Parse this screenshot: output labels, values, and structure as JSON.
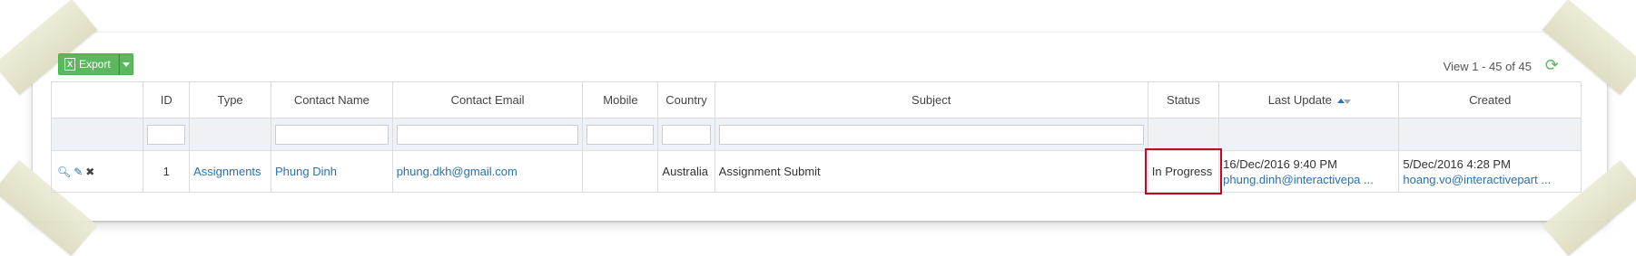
{
  "toolbar": {
    "export_label": "Export",
    "view_info": "View 1 - 45 of 45"
  },
  "icons": {
    "export": "excel-icon",
    "caret": "chevron-down-icon",
    "refresh": "refresh-icon",
    "view": "zoom-icon",
    "edit": "edit-icon",
    "delete": "close-icon",
    "sort": "sort-icon"
  },
  "colors": {
    "accent_green": "#5cb85c",
    "link_blue": "#2a6fb7",
    "highlight_red": "#d0021b",
    "filter_row_bg": "#eef2f7"
  },
  "columns": {
    "actions": "",
    "id": "ID",
    "type": "Type",
    "contact_name": "Contact Name",
    "contact_email": "Contact Email",
    "mobile": "Mobile",
    "country": "Country",
    "subject": "Subject",
    "status": "Status",
    "last_update": "Last Update",
    "created": "Created"
  },
  "rows": [
    {
      "id": "1",
      "type": "Assignments",
      "contact_name": "Phung Dinh",
      "contact_email": "phung.dkh@gmail.com",
      "mobile": "",
      "country": "Australia",
      "subject": "Assignment Submit",
      "status": "In Progress",
      "last_update_date": "16/Dec/2016 9:40 PM",
      "last_update_by": "phung.dinh@interactivepa ...",
      "created_date": "5/Dec/2016 4:28 PM",
      "created_by": "hoang.vo@interactivepart ..."
    }
  ]
}
